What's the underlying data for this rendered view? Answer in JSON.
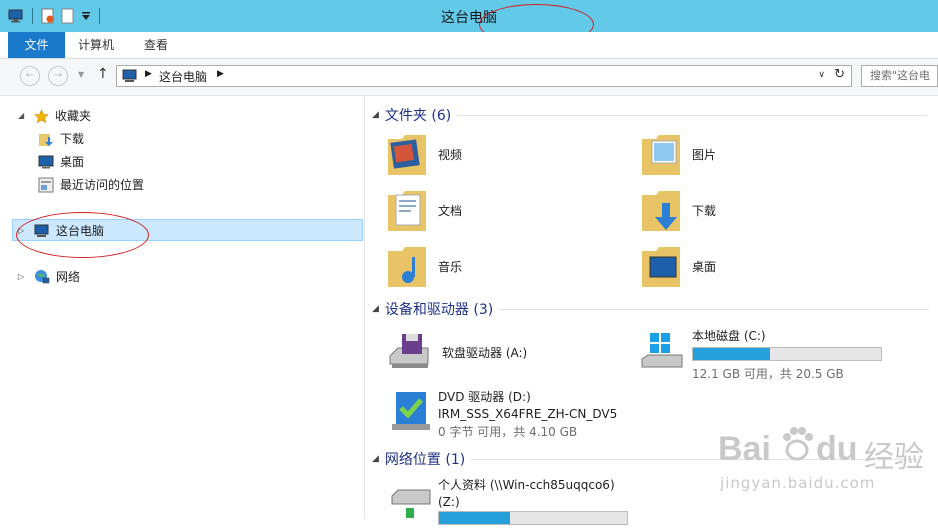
{
  "window": {
    "title": "这台电脑"
  },
  "ribbon": {
    "tabs": [
      "文件",
      "计算机",
      "查看"
    ]
  },
  "address": {
    "path": [
      "这台电脑"
    ],
    "search_placeholder": "搜索\"这台电"
  },
  "nav": {
    "favorites": "收藏夹",
    "favorites_items": [
      "下载",
      "桌面",
      "最近访问的位置"
    ],
    "this_pc": "这台电脑",
    "network": "网络"
  },
  "sections": {
    "folders": "文件夹 (6)",
    "devices": "设备和驱动器 (3)",
    "network_locations": "网络位置 (1)"
  },
  "folders": [
    "视频",
    "图片",
    "文档",
    "下载",
    "音乐",
    "桌面"
  ],
  "drives": [
    {
      "name": "软盘驱动器 (A:)"
    },
    {
      "name": "本地磁盘 (C:)",
      "usage": "12.1 GB 可用，共 20.5 GB",
      "used_fraction": 0.41
    },
    {
      "name": "DVD 驱动器 (D:)",
      "label": "IRM_SSS_X64FRE_ZH-CN_DV5",
      "usage": "0 字节 可用，共 4.10 GB"
    }
  ],
  "network_location": {
    "name": "个人资料 (\\\\Win-cch85uqqco6)",
    "drive": "(Z:)",
    "used_fraction": 0.38
  },
  "watermark": {
    "brand": "Bai",
    "brand2": "du",
    "cn": "经验",
    "url": "jingyan.baidu.com"
  },
  "colors": {
    "title_bar": "#62c9e8",
    "file_tab": "#1979ca",
    "selection": "#cce8ff",
    "section_text": "#1e3287",
    "annotation": "#d42020"
  }
}
